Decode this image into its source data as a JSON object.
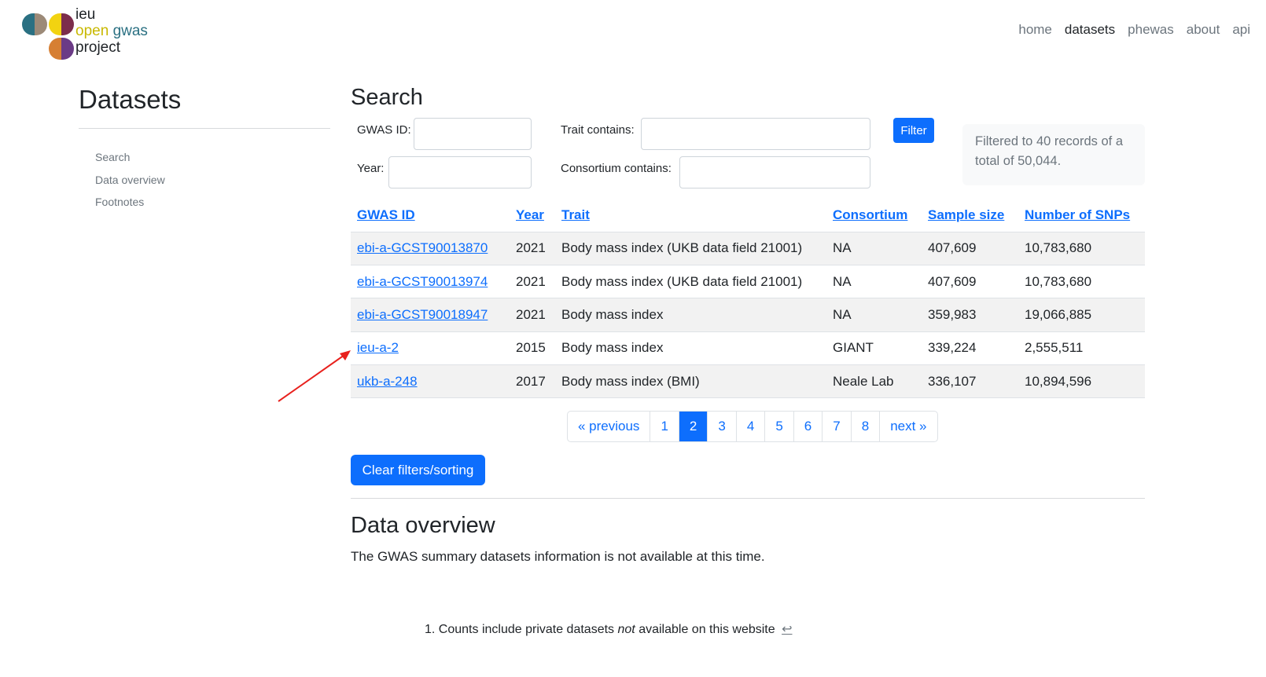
{
  "logo": {
    "line1": "ieu",
    "line2a": "open",
    "line2b": "gwas",
    "line3": "project"
  },
  "nav": {
    "home": "home",
    "datasets": "datasets",
    "phewas": "phewas",
    "about": "about",
    "api": "api"
  },
  "sidebar": {
    "title": "Datasets",
    "items": [
      "Search",
      "Data overview",
      "Footnotes"
    ]
  },
  "search": {
    "title": "Search",
    "gwas_id_label": "GWAS ID:",
    "year_label": "Year:",
    "trait_label": "Trait contains:",
    "consortium_label": "Consortium contains:",
    "gwas_id_value": "",
    "year_value": "",
    "trait_value": "",
    "consortium_value": "",
    "filter_label": "Filter",
    "status": "Filtered to 40 records of a total of 50,044."
  },
  "table": {
    "headers": [
      "GWAS ID",
      "Year",
      "Trait",
      "Consortium",
      "Sample size",
      "Number of SNPs"
    ],
    "rows": [
      [
        "ebi-a-GCST90013870",
        "2021",
        "Body mass index (UKB data field 21001)",
        "NA",
        "407,609",
        "10,783,680"
      ],
      [
        "ebi-a-GCST90013974",
        "2021",
        "Body mass index (UKB data field 21001)",
        "NA",
        "407,609",
        "10,783,680"
      ],
      [
        "ebi-a-GCST90018947",
        "2021",
        "Body mass index",
        "NA",
        "359,983",
        "19,066,885"
      ],
      [
        "ieu-a-2",
        "2015",
        "Body mass index",
        "GIANT",
        "339,224",
        "2,555,511"
      ],
      [
        "ukb-a-248",
        "2017",
        "Body mass index (BMI)",
        "Neale Lab",
        "336,107",
        "10,894,596"
      ]
    ]
  },
  "pagination": {
    "previous": "« previous",
    "pages": [
      "1",
      "2",
      "3",
      "4",
      "5",
      "6",
      "7",
      "8"
    ],
    "current": "2",
    "next": "next »"
  },
  "clear_label": "Clear filters/sorting",
  "overview": {
    "title": "Data overview",
    "text": "The GWAS summary datasets information is not available at this time."
  },
  "footnote": {
    "number": "1.",
    "before": "Counts include private datasets",
    "em": "not",
    "after": "available on this website",
    "backref": "↩"
  },
  "annotation": {
    "arrow_color": "#e8211d"
  }
}
